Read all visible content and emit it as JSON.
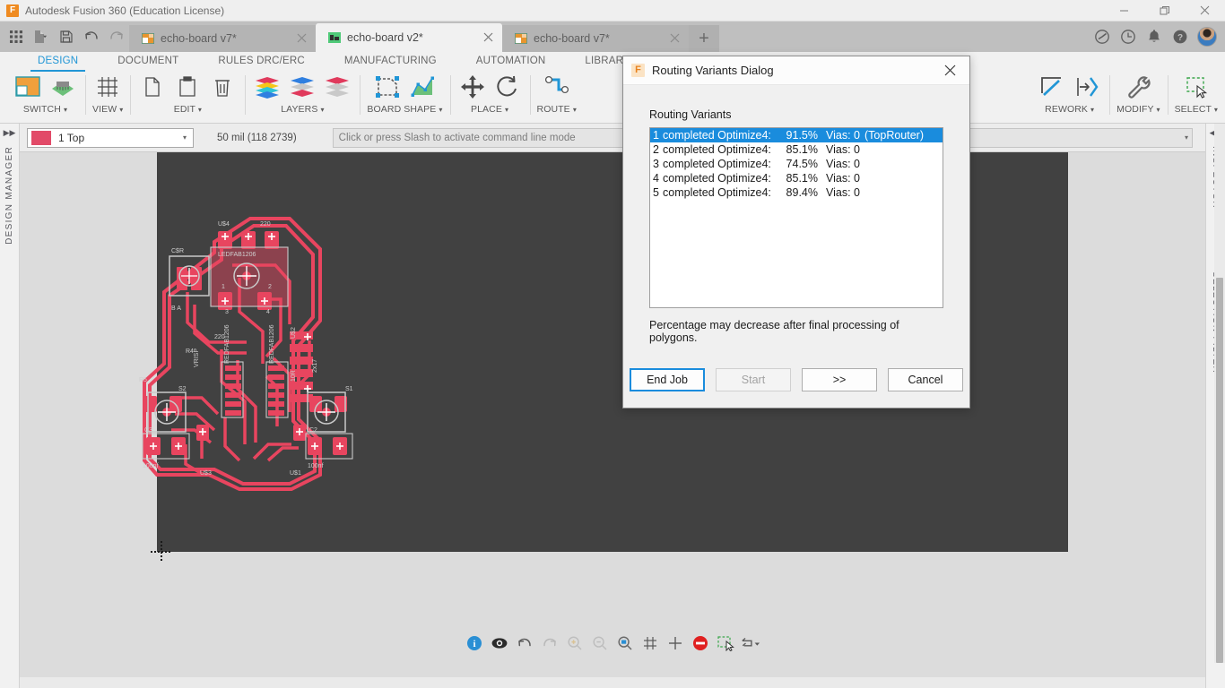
{
  "window": {
    "title": "Autodesk Fusion 360 (Education License)",
    "minimize": "—",
    "restore": "❐",
    "close": "✕"
  },
  "quick_access": [
    {
      "name": "grid-apps-icon",
      "label": ""
    },
    {
      "name": "new-file-icon",
      "label": ""
    },
    {
      "name": "save-icon",
      "label": ""
    },
    {
      "name": "undo-icon",
      "label": ""
    },
    {
      "name": "redo-icon",
      "label": ""
    }
  ],
  "tabs": [
    {
      "label": "echo-board v7*",
      "icon": "board-icon-orange",
      "active": false
    },
    {
      "label": "echo-board v2*",
      "icon": "board-icon-green",
      "active": true
    },
    {
      "label": "echo-board v7*",
      "icon": "board-icon-orange",
      "active": false
    }
  ],
  "tab_add_label": "+",
  "header_icons": [
    {
      "name": "job-status-icon"
    },
    {
      "name": "recent-activity-icon"
    },
    {
      "name": "notifications-bell-icon"
    },
    {
      "name": "help-icon"
    }
  ],
  "ribbon": {
    "tabs": [
      {
        "label": "DESIGN",
        "active": true
      },
      {
        "label": "DOCUMENT",
        "active": false
      },
      {
        "label": "RULES DRC/ERC",
        "active": false
      },
      {
        "label": "MANUFACTURING",
        "active": false
      },
      {
        "label": "AUTOMATION",
        "active": false
      },
      {
        "label": "LIBRARY",
        "active": false
      }
    ],
    "groups": [
      {
        "label": "SWITCH",
        "caret": "▾",
        "icons": [
          "switch-schematic-icon",
          "switch-board-icon"
        ]
      },
      {
        "label": "VIEW",
        "caret": "▾",
        "icons": [
          "grid-view-icon"
        ]
      },
      {
        "label": "EDIT",
        "caret": "▾",
        "icons": [
          "copy-icon",
          "paste-icon",
          "delete-icon"
        ]
      },
      {
        "label": "LAYERS",
        "caret": "▾",
        "icons": [
          "layers-all-icon",
          "layers-top-icon",
          "layers-bottom-icon"
        ]
      },
      {
        "label": "BOARD SHAPE",
        "caret": "▾",
        "icons": [
          "board-outline-icon",
          "board-polygon-icon"
        ]
      },
      {
        "label": "PLACE",
        "caret": "▾",
        "icons": [
          "move-icon",
          "rotate-icon"
        ]
      },
      {
        "label": "ROUTE",
        "caret": "▾",
        "icons": [
          "route-trace-icon"
        ]
      },
      {
        "label": "REWORK",
        "caret": "▾",
        "icons": [
          "rework-miter-icon",
          "rework-extend-icon"
        ]
      },
      {
        "label": "MODIFY",
        "caret": "▾",
        "icons": [
          "wrench-icon"
        ]
      },
      {
        "label": "SELECT",
        "caret": "▾",
        "icons": [
          "marquee-select-icon"
        ]
      }
    ]
  },
  "layerbar": {
    "expand_icon": "▶▶",
    "layer_color": "#e24a68",
    "layer_name": "1 Top",
    "layer_caret": "▾",
    "grid_info": "50 mil (118 2739)",
    "command_placeholder": "Click or press Slash to activate command line mode",
    "command_value": "",
    "command_caret": "▾"
  },
  "rails": {
    "left": {
      "toggle": "▶▶",
      "label": "DESIGN MANAGER"
    },
    "right": {
      "toggle": "◀◀",
      "labels": [
        "INSPECTOR",
        "SELECTION FILTER"
      ]
    }
  },
  "canvas": {
    "background": "#dcdcdc",
    "board_background": "#414141",
    "trace_color": "#e8455f",
    "silkscreen_color": "#d0d0d0",
    "origin_marker": "crosshair-origin-marker"
  },
  "bottom_toolbar": [
    {
      "name": "info-icon",
      "state": "active"
    },
    {
      "name": "visibility-eye-icon",
      "state": "active"
    },
    {
      "name": "undo-icon",
      "state": "active"
    },
    {
      "name": "redo-icon",
      "state": "dim"
    },
    {
      "name": "zoom-in-icon",
      "state": "dim"
    },
    {
      "name": "zoom-out-icon",
      "state": "dim"
    },
    {
      "name": "zoom-fit-icon",
      "state": "active"
    },
    {
      "name": "grid-toggle-icon",
      "state": "active"
    },
    {
      "name": "crosshair-icon",
      "state": "active"
    },
    {
      "name": "stop-icon",
      "state": "active"
    },
    {
      "name": "marquee-select-icon",
      "state": "active"
    },
    {
      "name": "snap-dropdown-icon",
      "state": "active"
    }
  ],
  "dialog": {
    "icon": "fusion-f-icon",
    "title": "Routing Variants Dialog",
    "close_label": "✕",
    "heading": "Routing Variants",
    "note": "Percentage may decrease after final processing of polygons.",
    "selected_index": 0,
    "variants": [
      {
        "index": "1",
        "state": "completed Optimize4:",
        "percent": "91.5%",
        "vias": "Vias: 0",
        "note": "(TopRouter)"
      },
      {
        "index": "2",
        "state": "completed Optimize4:",
        "percent": "85.1%",
        "vias": "Vias: 0",
        "note": ""
      },
      {
        "index": "3",
        "state": "completed Optimize4:",
        "percent": "74.5%",
        "vias": "Vias: 0",
        "note": ""
      },
      {
        "index": "4",
        "state": "completed Optimize4:",
        "percent": "85.1%",
        "vias": "Vias: 0",
        "note": ""
      },
      {
        "index": "5",
        "state": "completed Optimize4:",
        "percent": "89.4%",
        "vias": "Vias: 0",
        "note": ""
      }
    ],
    "buttons": [
      {
        "label": "End Job",
        "style": "primary",
        "name": "end-job-button"
      },
      {
        "label": "Start",
        "style": "disabled",
        "name": "start-button"
      },
      {
        "label": ">>",
        "style": "normal",
        "name": "next-button"
      },
      {
        "label": "Cancel",
        "style": "normal",
        "name": "cancel-button"
      }
    ]
  }
}
